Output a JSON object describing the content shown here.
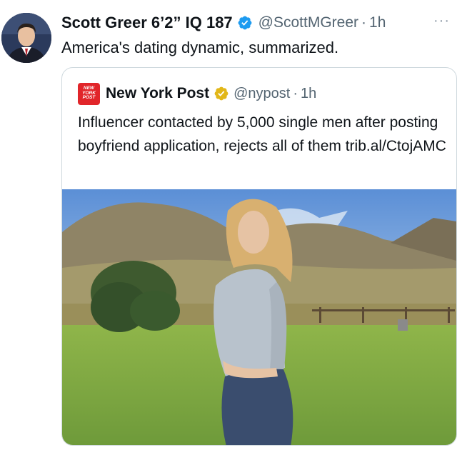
{
  "tweet": {
    "author_name": "Scott Greer 6’2” IQ 187",
    "handle": "@ScottMGreer",
    "separator": "·",
    "time": "1h",
    "more_icon": "···",
    "text": "America's dating dynamic, summarized."
  },
  "quote": {
    "logo_lines": [
      "NEW",
      "YORK",
      "POST"
    ],
    "author_name": "New York Post",
    "handle": "@nypost",
    "separator": "·",
    "time": "1h",
    "text": "Influencer contacted by 5,000 single men after posting boyfriend application, rejects all of them trib.al/CtojAMC"
  },
  "icons": {
    "author_verified": "verified-badge-blue",
    "quote_verified": "verified-badge-gold",
    "more": "more-options-icon"
  },
  "colors": {
    "verified_blue": "#1d9bf0",
    "verified_gold": "#e2b719",
    "nypost_red": "#e1252a",
    "secondary_text": "#536471",
    "border": "#cfd9de"
  }
}
